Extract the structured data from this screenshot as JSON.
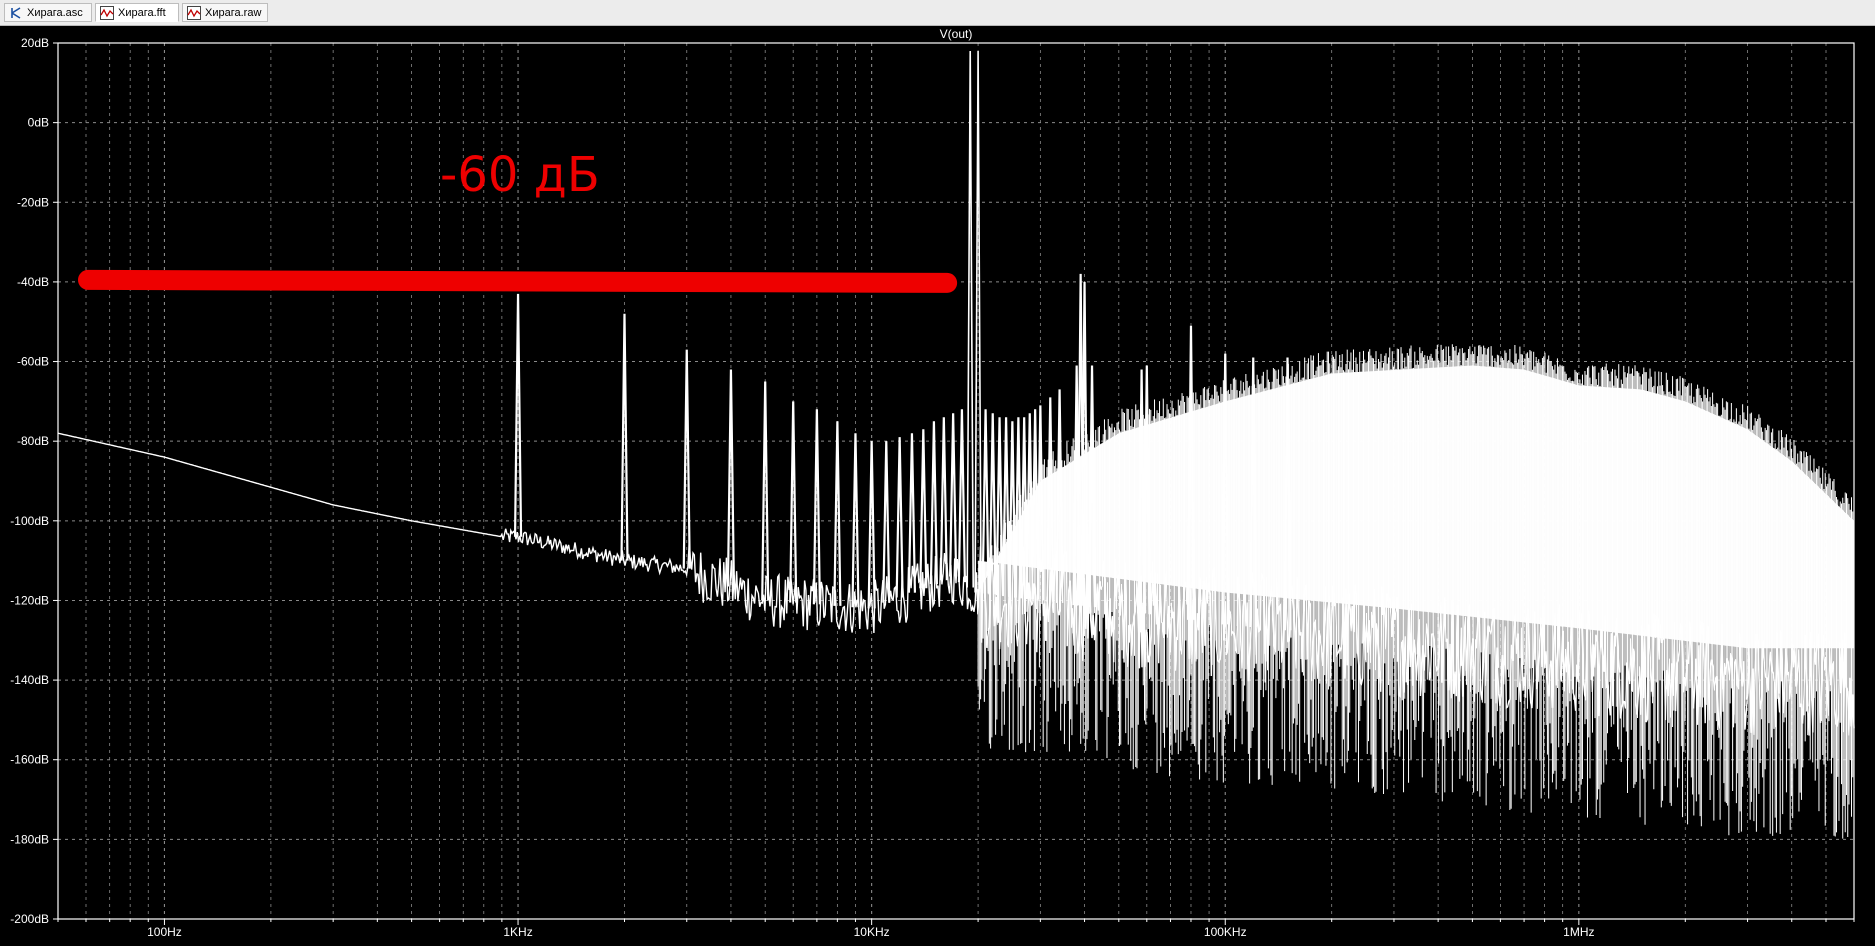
{
  "tabs": [
    {
      "label": "Хирага.asc",
      "icon": "schematic-icon"
    },
    {
      "label": "Хирага.fft",
      "icon": "waveform-icon"
    },
    {
      "label": "Хирага.raw",
      "icon": "waveform-icon"
    }
  ],
  "chart_data": {
    "type": "line",
    "title": "V(out)",
    "xlabel": "",
    "ylabel": "",
    "x_scale": "log",
    "xlim": [
      50,
      6000000
    ],
    "ylim": [
      -200,
      20
    ],
    "y_ticks": [
      "20dB",
      "0dB",
      "-20dB",
      "-40dB",
      "-60dB",
      "-80dB",
      "-100dB",
      "-120dB",
      "-140dB",
      "-160dB",
      "-180dB",
      "-200dB"
    ],
    "x_ticks": [
      "100Hz",
      "1KHz",
      "10KHz",
      "100KHz",
      "1MHz"
    ],
    "grid": true,
    "colors": {
      "background": "#000000",
      "trace": "#ffffff",
      "grid": "#8a8a8a",
      "annotation": "#ee0000"
    },
    "series": [
      {
        "noise_floor": [
          [
            50,
            -78
          ],
          [
            100,
            -84
          ],
          [
            300,
            -96
          ],
          [
            500,
            -100
          ],
          [
            900,
            -104
          ],
          [
            1000,
            -104
          ],
          [
            2000,
            -110
          ],
          [
            3000,
            -112
          ],
          [
            5000,
            -120
          ],
          [
            10000,
            -122
          ],
          [
            17000,
            -114
          ],
          [
            20000,
            -118
          ],
          [
            30000,
            -120
          ],
          [
            100000,
            -126
          ],
          [
            300000,
            -130
          ],
          [
            1000000,
            -135
          ],
          [
            3000000,
            -140
          ],
          [
            6000000,
            -140
          ]
        ],
        "envelope": [
          [
            20000,
            -118
          ],
          [
            30000,
            -90
          ],
          [
            50000,
            -78
          ],
          [
            100000,
            -70
          ],
          [
            200000,
            -63
          ],
          [
            500000,
            -61
          ],
          [
            700000,
            -62
          ],
          [
            1000000,
            -66
          ],
          [
            1500000,
            -67
          ],
          [
            2000000,
            -70
          ],
          [
            3000000,
            -77
          ],
          [
            4000000,
            -85
          ],
          [
            6000000,
            -100
          ]
        ],
        "peaks": [
          [
            1000,
            -43
          ],
          [
            2000,
            -48
          ],
          [
            3000,
            -57
          ],
          [
            4000,
            -62
          ],
          [
            5000,
            -65
          ],
          [
            6000,
            -70
          ],
          [
            7000,
            -72
          ],
          [
            8000,
            -75
          ],
          [
            9000,
            -78
          ],
          [
            10000,
            -80
          ],
          [
            11000,
            -80
          ],
          [
            12000,
            -79
          ],
          [
            13000,
            -78
          ],
          [
            14000,
            -77
          ],
          [
            15000,
            -75
          ],
          [
            16000,
            -74
          ],
          [
            17000,
            -73
          ],
          [
            18000,
            -72
          ],
          [
            19000,
            18
          ],
          [
            20000,
            18
          ],
          [
            21000,
            -72
          ],
          [
            22000,
            -73
          ],
          [
            23000,
            -74
          ],
          [
            24000,
            -74
          ],
          [
            25000,
            -75
          ],
          [
            26000,
            -74
          ],
          [
            27000,
            -74
          ],
          [
            28000,
            -73
          ],
          [
            29000,
            -72
          ],
          [
            30000,
            -71
          ],
          [
            32000,
            -69
          ],
          [
            34000,
            -67
          ],
          [
            38000,
            -61
          ],
          [
            39000,
            -38
          ],
          [
            40000,
            -40
          ],
          [
            42000,
            -61
          ],
          [
            58000,
            -62
          ],
          [
            60000,
            -61
          ],
          [
            80000,
            -51
          ],
          [
            100000,
            -58
          ],
          [
            120000,
            -59
          ],
          [
            150000,
            -59
          ]
        ]
      }
    ],
    "annotation": {
      "label": "-60 дБ",
      "line_level_db": -40,
      "line_from_hz": 50,
      "line_to_hz": 17000
    }
  }
}
